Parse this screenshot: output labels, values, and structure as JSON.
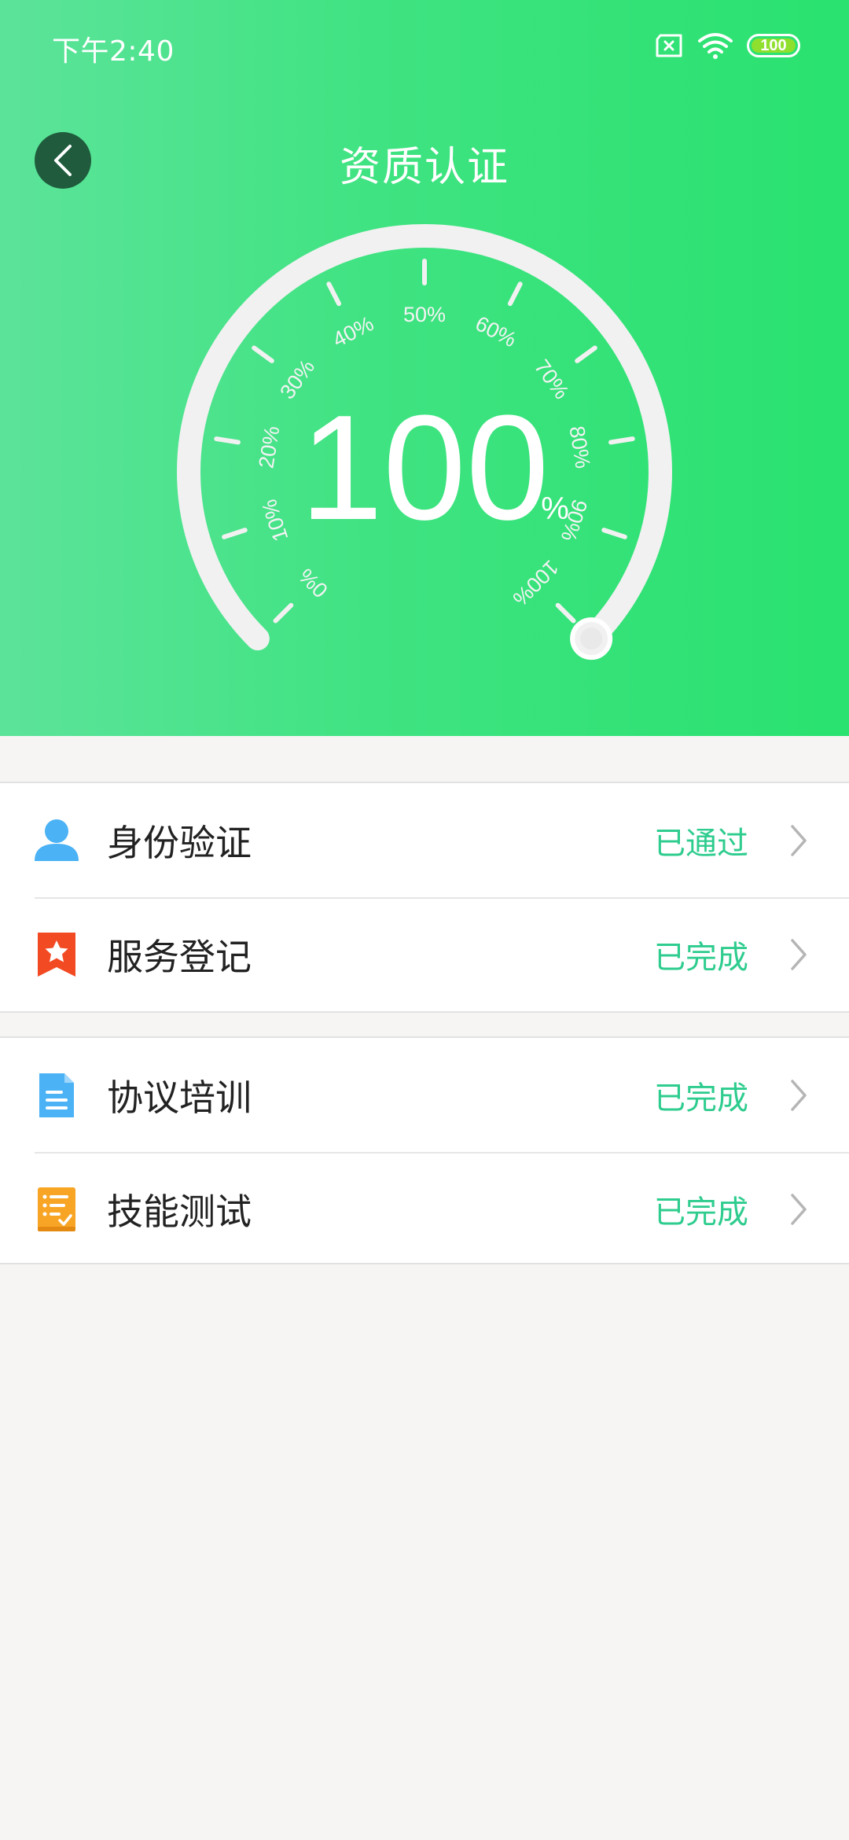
{
  "status_bar": {
    "time": "下午2:40",
    "battery": "100",
    "icons": [
      "sim-x-icon",
      "wifi-icon",
      "battery-icon"
    ]
  },
  "header": {
    "title": "资质认证",
    "back_icon": "chevron-left-icon"
  },
  "gauge": {
    "value": "100",
    "unit": "%",
    "progress_fraction": 1.0,
    "tick_labels": [
      "0%",
      "10%",
      "20%",
      "30%",
      "40%",
      "50%",
      "60%",
      "70%",
      "80%",
      "90%",
      "100%"
    ]
  },
  "groups": [
    {
      "items": [
        {
          "label": "身份验证",
          "status": "已通过",
          "icon": "person-icon"
        },
        {
          "label": "服务登记",
          "status": "已完成",
          "icon": "star-bookmark-icon"
        }
      ]
    },
    {
      "items": [
        {
          "label": "协议培训",
          "status": "已完成",
          "icon": "document-icon"
        },
        {
          "label": "技能测试",
          "status": "已完成",
          "icon": "checklist-icon"
        }
      ]
    }
  ],
  "colors": {
    "header_start": "#5ce39a",
    "header_end": "#29e26f",
    "status_text": "#2ecc8e",
    "back_button": "#1f5b3c"
  }
}
